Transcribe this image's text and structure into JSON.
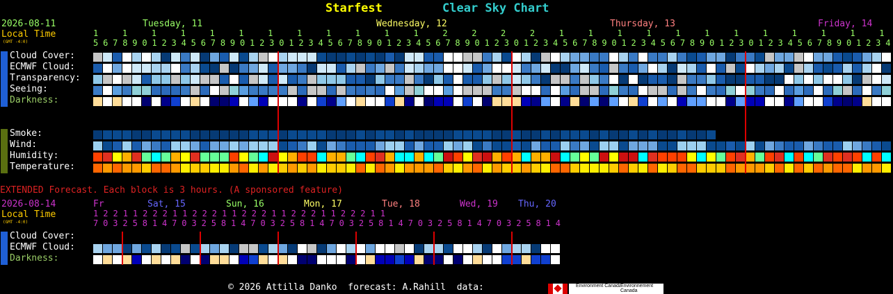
{
  "header": {
    "site_title": "Starfest",
    "chart_title": "Clear Sky Chart",
    "site_color": "#ffff00",
    "chart_color": "#33cccc"
  },
  "left_info": {
    "date": "2026-08-11",
    "local_time": "Local Time",
    "gmt": "(GMT -4:0)"
  },
  "days": [
    {
      "label": "Tuesday, 11",
      "color": "#99ff66"
    },
    {
      "label": "Wednesday, 12",
      "color": "#ffff66"
    },
    {
      "label": "Thursday, 13",
      "color": "#ff8080"
    },
    {
      "label": "Friday, 14",
      "color": "#cc33cc"
    }
  ],
  "hour_labels": {
    "tens": "      1 1 1 1 1 1 1 1 1 1 1 1 2 2 2 2                1 1 1 1 1 1 1 1 1 1 1 1 2 2 2 2                1 1 1 1 1 1 1 1 1 1 1 1 2 2 2 2                1 1 1 1 1",
    "ones": "5 6 7 8 9 0 1 2 3 4 5 6 7 8 9 0 1 2 3 0 1 2 3 4 5 6 7 8 9 0 1 2 3 4 5 6 7 8 9 0 1 2 3 0 1 2 3 4 5 6 7 8 9 0 1 2 3 4 5 6 7 8 9 0 1 2 3 0 1 2 3 4 5 6 7 8 9 0 1 2 3 4 5 6 7 8 9 0 1 2 3 0 1 2 3 4 5 6 7 8 9 0 1 2 3 4"
  },
  "sky_tab": "Sky",
  "ground_tab": "Ground",
  "rows_sky": [
    {
      "label": "Cloud Cover:",
      "color": "#ffffff"
    },
    {
      "label": "ECMWF Cloud:",
      "color": "#ffffff"
    },
    {
      "label": "Transparency:",
      "color": "#ffffff"
    },
    {
      "label": "Seeing:",
      "color": "#ffffff"
    },
    {
      "label": "Darkness:",
      "color": "#99cc66"
    }
  ],
  "rows_ground": [
    {
      "label": "Smoke:",
      "color": "#ffffff"
    },
    {
      "label": "Wind:",
      "color": "#ffffff"
    },
    {
      "label": "Humidity:",
      "color": "#ffffff"
    },
    {
      "label": "Temperature:",
      "color": "#ffffff"
    }
  ],
  "extended": {
    "note": "EXTENDED Forecast. Each block is 3 hours. (A sponsored feature)",
    "date": "2026-08-14",
    "local_time": "Local Time",
    "gmt": "(GMT -4:0)",
    "days": [
      {
        "label": "Fr",
        "color": "#cc33cc"
      },
      {
        "label": "Sat, 15",
        "color": "#6666ff"
      },
      {
        "label": "Sun, 16",
        "color": "#99ff66"
      },
      {
        "label": "Mon, 17",
        "color": "#ffff66"
      },
      {
        "label": "Tue, 18",
        "color": "#ff8080"
      },
      {
        "label": "Wed, 19",
        "color": "#cc33cc"
      },
      {
        "label": "Thu, 20",
        "color": "#6666ff"
      }
    ],
    "tens": "1 2 2     1 1 2 2 2     1 1 2 2 2     1 1 2 2 2     1 1 2 2 2     1 1 2 2 2     1 1",
    "ones": "7 0 3 2 5 8 1 4 7 0 3 2 5 8 1 4 7 0 3 2 5 8 1 4 7 0 3 2 5 8 1 4 7 0 3 2 5 8 1 4 7 0 3 2 5 8 1 4",
    "rows": [
      {
        "label": "Cloud Cover:",
        "color": "#ffffff"
      },
      {
        "label": "ECMWF Cloud:",
        "color": "#ffffff"
      },
      {
        "label": "Darkness:",
        "color": "#99cc66"
      }
    ]
  },
  "footer": {
    "credits": "© 2026 Attilla Danko  forecast: A.Rahill  data:",
    "env_en": "Environment Canada",
    "env_fr": "Environnement Canada"
  }
}
